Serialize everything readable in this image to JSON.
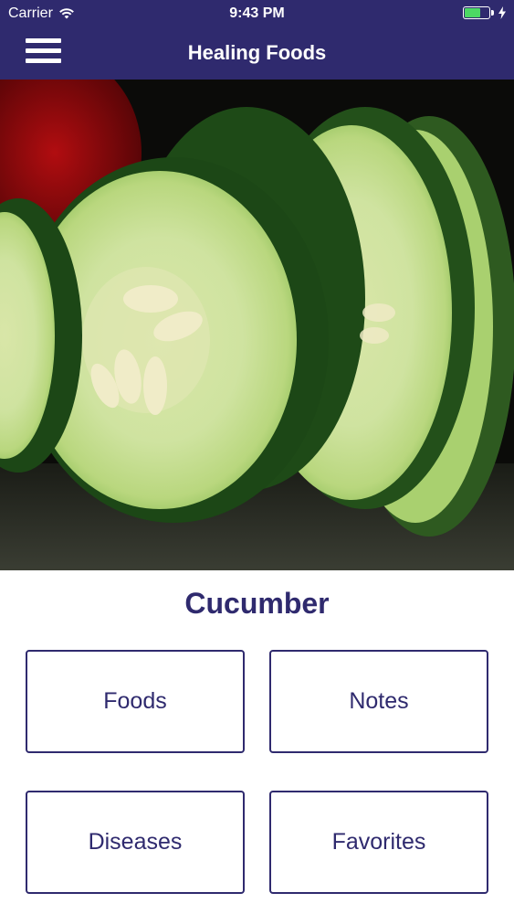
{
  "status_bar": {
    "carrier": "Carrier",
    "time": "9:43 PM",
    "wifi_icon": "wifi-icon",
    "battery_icon": "battery-icon",
    "charging_icon": "charging-bolt-icon"
  },
  "navbar": {
    "title": "Healing Foods",
    "menu_icon": "hamburger-menu-icon",
    "background_color": "#2f2a6e"
  },
  "hero": {
    "subject": "cucumber slices photo"
  },
  "food": {
    "name": "Cucumber"
  },
  "tiles": {
    "foods": "Foods",
    "notes": "Notes",
    "diseases": "Diseases",
    "favorites": "Favorites"
  },
  "colors": {
    "accent": "#2f2a6e",
    "battery_fill": "#4cd964"
  }
}
